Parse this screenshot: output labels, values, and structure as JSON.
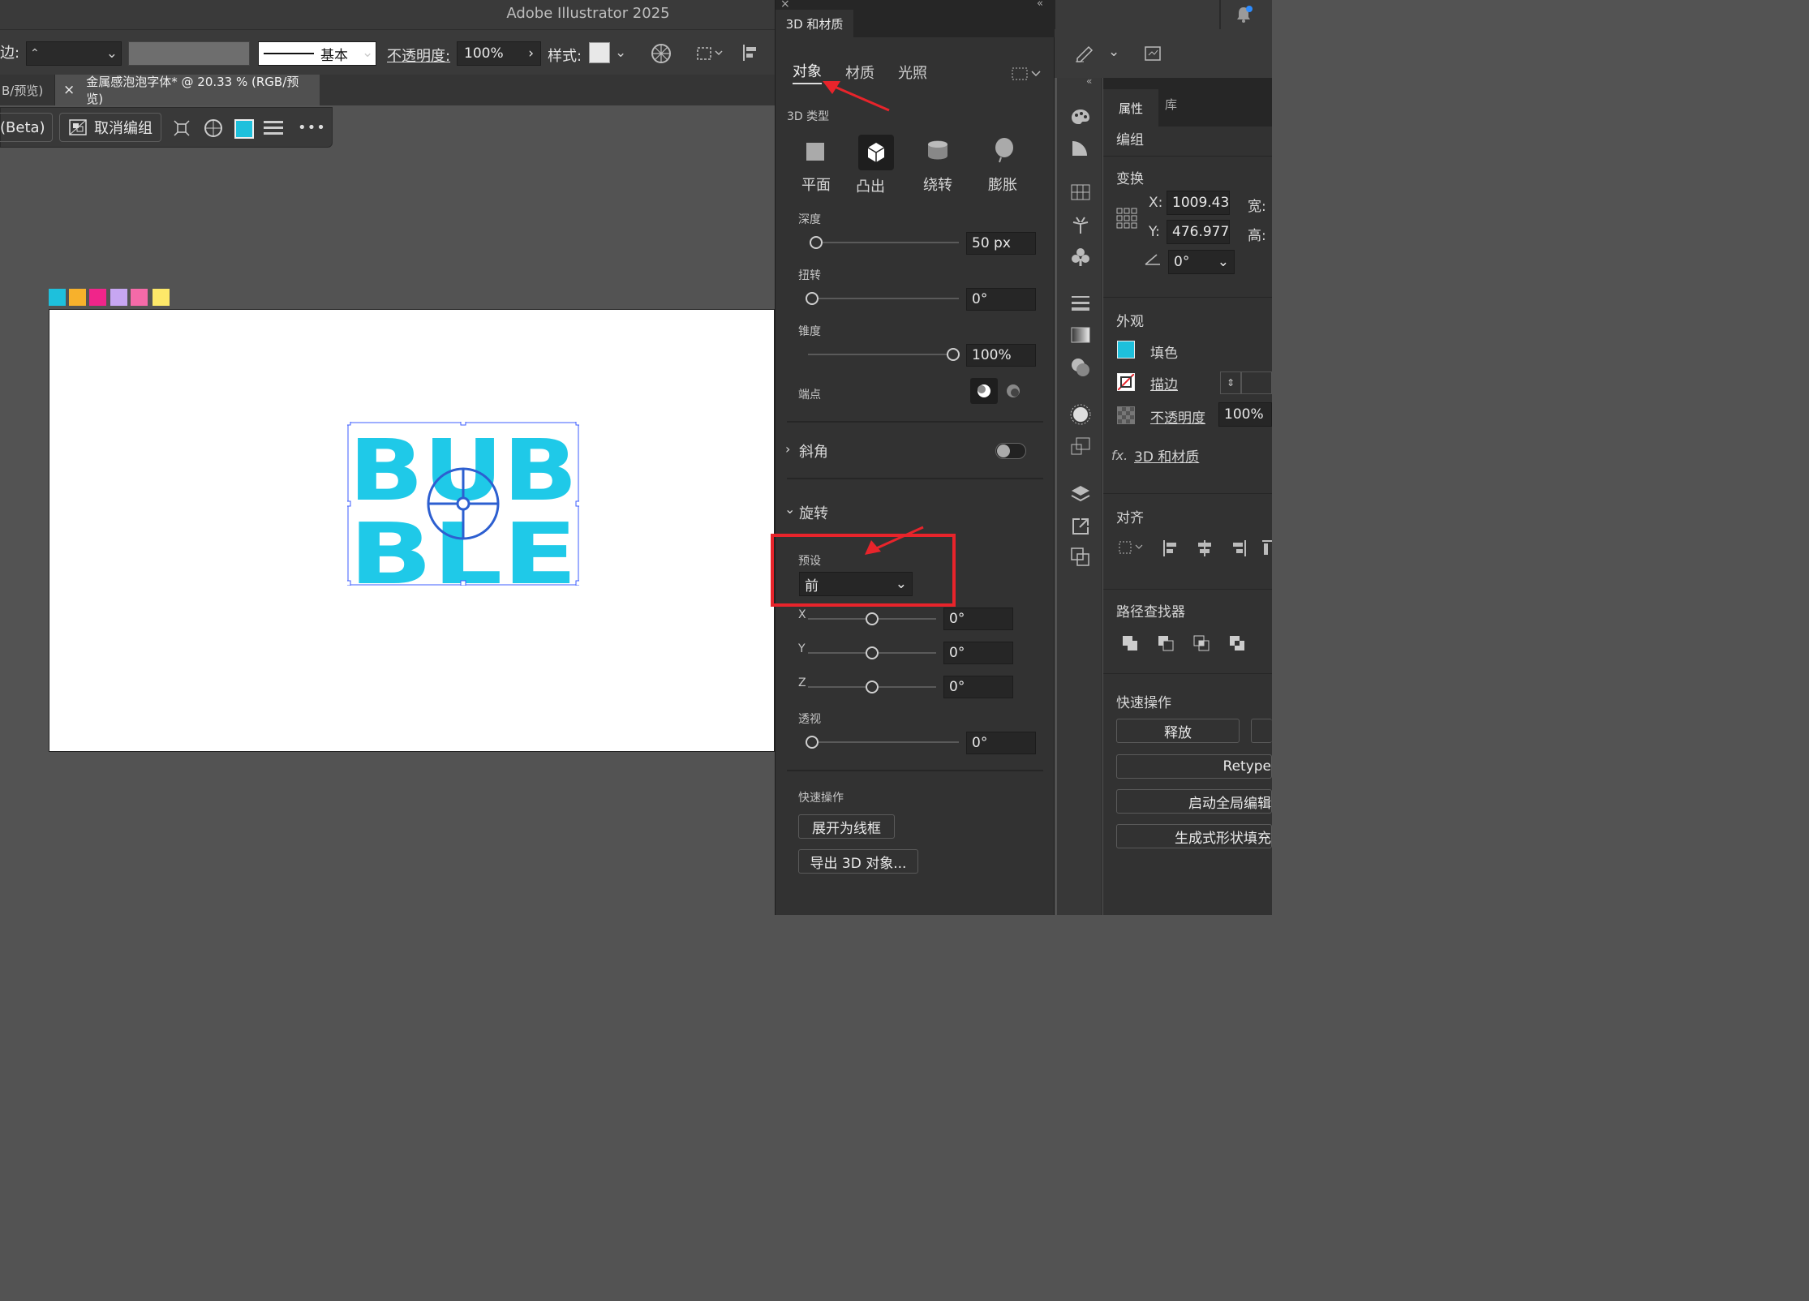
{
  "app": {
    "title": "Adobe Illustrator 2025"
  },
  "control_bar": {
    "stroke_label": "边:",
    "stroke_profile": "基本",
    "opacity_label": "不透明度:",
    "opacity_value": "100%",
    "style_label": "样式:"
  },
  "doc_tabs": [
    {
      "label": "B/预览)"
    },
    {
      "label": "金属感泡泡字体* @ 20.33 % (RGB/预览)",
      "close": "×"
    }
  ],
  "context_bar": {
    "beta_label": "(Beta)",
    "ungroup_label": "取消编组",
    "more": "•••"
  },
  "swatches": [
    "#1ec0dc",
    "#f7b12c",
    "#f0258a",
    "#c7a6f2",
    "#f56aa8",
    "#fde869"
  ],
  "artwork": {
    "text_line1": "BUB",
    "text_line2": "BLE",
    "fill_color": "#1fc9e8"
  },
  "panel_3d": {
    "tab_label": "3D 和材质",
    "tabs": [
      "对象",
      "材质",
      "光照"
    ],
    "type_section_label": "3D 类型",
    "types": [
      "平面",
      "凸出",
      "绕转",
      "膨胀"
    ],
    "depth": {
      "label": "深度",
      "value": "50 px"
    },
    "twist": {
      "label": "扭转",
      "value": "0°"
    },
    "taper": {
      "label": "锥度",
      "value": "100%"
    },
    "cap_label": "端点",
    "bevel_label": "斜角",
    "rotation_label": "旋转",
    "preset_label": "预设",
    "preset_value": "前",
    "axes": [
      {
        "axis": "X",
        "value": "0°"
      },
      {
        "axis": "Y",
        "value": "0°"
      },
      {
        "axis": "Z",
        "value": "0°"
      }
    ],
    "perspective": {
      "label": "透视",
      "value": "0°"
    },
    "quick_actions_label": "快速操作",
    "expand_wireframe": "展开为线框",
    "export_3d": "导出 3D 对象..."
  },
  "properties": {
    "tabs": [
      "属性",
      "库"
    ],
    "group_label": "编组",
    "transform_label": "变换",
    "x_label": "X:",
    "x_value": "1009.43",
    "y_label": "Y:",
    "y_value": "476.977",
    "w_label": "宽:",
    "h_label": "高:",
    "angle_value": "0°",
    "appearance_label": "外观",
    "fill_label": "填色",
    "stroke_label": "描边",
    "opacity_label": "不透明度",
    "opacity_value": "100%",
    "effect_label": "3D 和材质",
    "fx": "fx.",
    "align_label": "对齐",
    "pathfinder_label": "路径查找器",
    "quick_actions_label": "快速操作",
    "release": "释放",
    "retype": "Retype",
    "global_edit": "启动全局编辑",
    "gen_shape_fill": "生成式形状填充"
  },
  "colors": {
    "accent_cyan": "#1fc9e8",
    "annotation_red": "#e8242b",
    "selection_blue": "#3c5cff"
  }
}
